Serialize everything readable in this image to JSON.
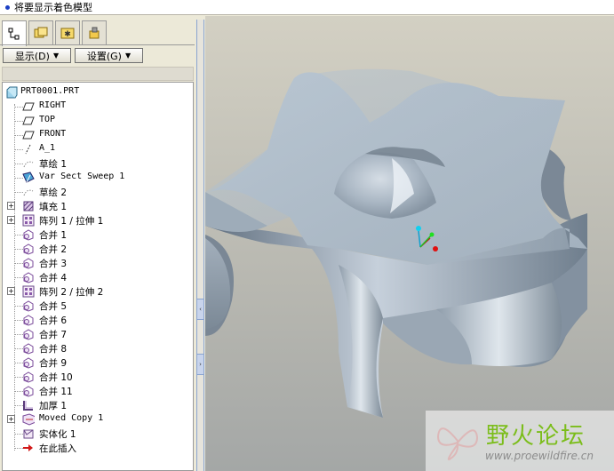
{
  "status": {
    "text": "将要显示着色模型"
  },
  "tabs": [
    {
      "icon": "model-tree-icon",
      "active": true
    },
    {
      "icon": "folder-browser-icon",
      "active": false
    },
    {
      "icon": "favorites-icon",
      "active": false
    },
    {
      "icon": "connections-icon",
      "active": false
    }
  ],
  "toolbar": {
    "show_label": "显示(D)",
    "settings_label": "设置(G)"
  },
  "tree": {
    "items": [
      {
        "label": "PRT0001.PRT",
        "icon": "part-icon",
        "level": 0,
        "expandable": false,
        "mono": true
      },
      {
        "label": "RIGHT",
        "icon": "datum-plane-icon",
        "level": 1,
        "expandable": false,
        "mono": true
      },
      {
        "label": "TOP",
        "icon": "datum-plane-icon",
        "level": 1,
        "expandable": false,
        "mono": true
      },
      {
        "label": "FRONT",
        "icon": "datum-plane-icon",
        "level": 1,
        "expandable": false,
        "mono": true
      },
      {
        "label": "A_1",
        "icon": "datum-axis-icon",
        "level": 1,
        "expandable": false,
        "mono": true
      },
      {
        "label": "草绘 1",
        "icon": "sketch-icon",
        "level": 1,
        "expandable": false,
        "mono": false
      },
      {
        "label": "Var Sect Sweep 1",
        "icon": "sweep-icon",
        "level": 1,
        "expandable": false,
        "mono": true
      },
      {
        "label": "草绘 2",
        "icon": "sketch-icon",
        "level": 1,
        "expandable": false,
        "mono": false
      },
      {
        "label": "填充 1",
        "icon": "fill-icon",
        "level": 1,
        "expandable": true,
        "mono": false
      },
      {
        "label": "阵列 1 / 拉伸 1",
        "icon": "pattern-icon",
        "level": 1,
        "expandable": true,
        "mono": false
      },
      {
        "label": "合并 1",
        "icon": "merge-icon",
        "level": 1,
        "expandable": false,
        "mono": false
      },
      {
        "label": "合并 2",
        "icon": "merge-icon",
        "level": 1,
        "expandable": false,
        "mono": false
      },
      {
        "label": "合并 3",
        "icon": "merge-icon",
        "level": 1,
        "expandable": false,
        "mono": false
      },
      {
        "label": "合并 4",
        "icon": "merge-icon",
        "level": 1,
        "expandable": false,
        "mono": false
      },
      {
        "label": "阵列 2 / 拉伸 2",
        "icon": "pattern-icon",
        "level": 1,
        "expandable": true,
        "mono": false
      },
      {
        "label": "合并 5",
        "icon": "merge-icon",
        "level": 1,
        "expandable": false,
        "mono": false
      },
      {
        "label": "合并 6",
        "icon": "merge-icon",
        "level": 1,
        "expandable": false,
        "mono": false
      },
      {
        "label": "合并 7",
        "icon": "merge-icon",
        "level": 1,
        "expandable": false,
        "mono": false
      },
      {
        "label": "合并 8",
        "icon": "merge-icon",
        "level": 1,
        "expandable": false,
        "mono": false
      },
      {
        "label": "合并 9",
        "icon": "merge-icon",
        "level": 1,
        "expandable": false,
        "mono": false
      },
      {
        "label": "合并 10",
        "icon": "merge-icon",
        "level": 1,
        "expandable": false,
        "mono": false
      },
      {
        "label": "合并 11",
        "icon": "merge-icon",
        "level": 1,
        "expandable": false,
        "mono": false
      },
      {
        "label": "加厚 1",
        "icon": "thicken-icon",
        "level": 1,
        "expandable": false,
        "mono": false
      },
      {
        "label": "Moved Copy 1",
        "icon": "moved-copy-icon",
        "level": 1,
        "expandable": true,
        "mono": true
      },
      {
        "label": "实体化 1",
        "icon": "solidify-icon",
        "level": 1,
        "expandable": false,
        "mono": false
      },
      {
        "label": "在此插入",
        "icon": "insert-here-icon",
        "level": 1,
        "expandable": false,
        "mono": false
      }
    ]
  },
  "watermark": {
    "title": "野火论坛",
    "url": "www.proewildfire.cn"
  },
  "colors": {
    "accent": "#1b3fc4",
    "model_surface": "#aab7c4",
    "watermark_green": "#7bbd1a"
  }
}
